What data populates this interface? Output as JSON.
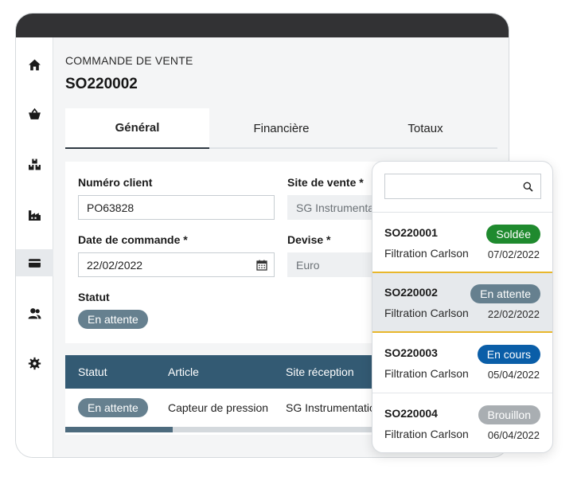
{
  "colors": {
    "topbar": "#323234",
    "table_header": "#335a73",
    "status_waiting": "#66808f",
    "status_settled": "#1f8a2e",
    "status_in_progress": "#0a5ea8",
    "status_draft": "#a9aeb2",
    "selected_accent": "#e8b72c"
  },
  "sidebar": {
    "items": [
      {
        "icon": "home-icon"
      },
      {
        "icon": "basket-icon"
      },
      {
        "icon": "boxes-icon"
      },
      {
        "icon": "factory-icon"
      },
      {
        "icon": "credit-card-icon",
        "active": true
      },
      {
        "icon": "users-icon"
      },
      {
        "icon": "gear-icon"
      }
    ]
  },
  "header": {
    "eyebrow": "COMMANDE DE VENTE",
    "title": "SO220002"
  },
  "tabs": [
    {
      "label": "Général",
      "active": true
    },
    {
      "label": "Financière"
    },
    {
      "label": "Totaux"
    }
  ],
  "form": {
    "customer_label": "Numéro client",
    "customer_value": "PO63828",
    "site_label": "Site de vente *",
    "site_value": "SG Instrumentation",
    "date_label": "Date de commande *",
    "date_value": "22/02/2022",
    "currency_label": "Devise *",
    "currency_value": "Euro",
    "status_label": "Statut",
    "status_value": "En attente"
  },
  "table": {
    "columns": [
      "Statut",
      "Article",
      "Site réception"
    ],
    "rows": [
      {
        "status": "En attente",
        "article": "Capteur de pression",
        "site": "SG Instrumentation"
      }
    ],
    "scroll_fraction": 0.25
  },
  "popup": {
    "search_value": "",
    "items": [
      {
        "id": "SO220001",
        "customer": "Filtration Carlson",
        "status": "Soldée",
        "date": "07/02/2022"
      },
      {
        "id": "SO220002",
        "customer": "Filtration Carlson",
        "status": "En attente",
        "date": "22/02/2022",
        "selected": true
      },
      {
        "id": "SO220003",
        "customer": "Filtration Carlson",
        "status": "En cours",
        "date": "05/04/2022"
      },
      {
        "id": "SO220004",
        "customer": "Filtration Carlson",
        "status": "Brouillon",
        "date": "06/04/2022"
      }
    ]
  }
}
